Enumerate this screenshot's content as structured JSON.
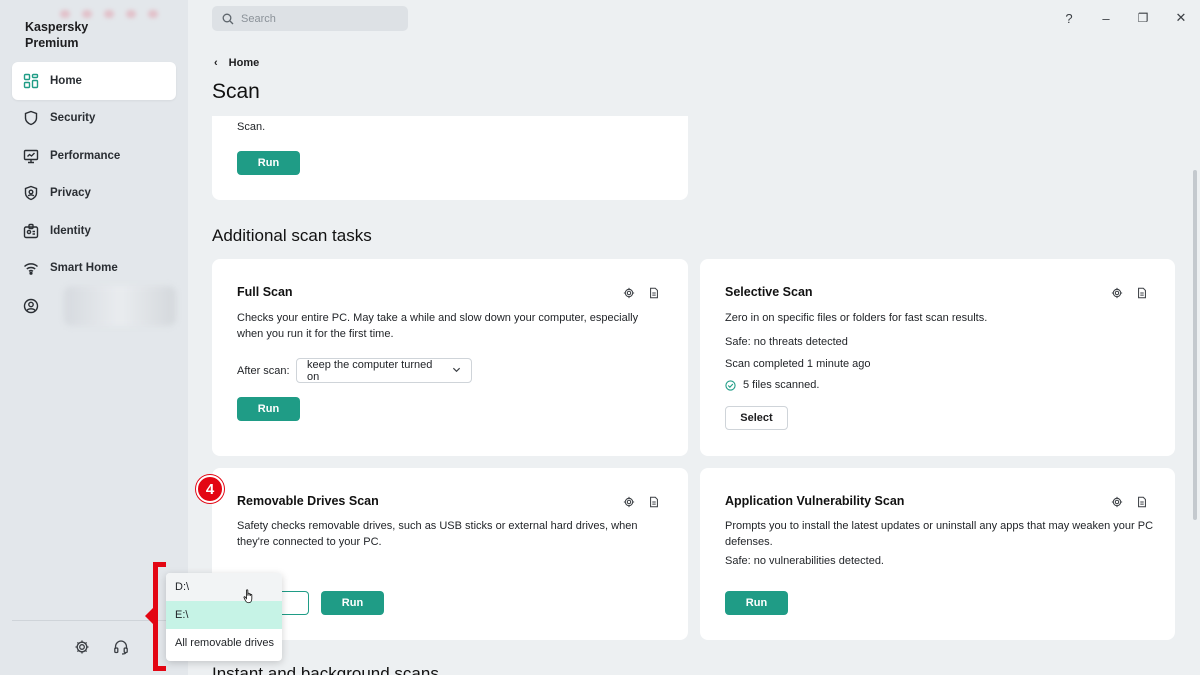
{
  "app": {
    "title_line1": "Kaspersky",
    "title_line2": "Premium"
  },
  "sidebar": {
    "items": [
      {
        "label": "Home",
        "icon": "home-icon",
        "active": true
      },
      {
        "label": "Security",
        "icon": "shield-icon"
      },
      {
        "label": "Performance",
        "icon": "performance-icon"
      },
      {
        "label": "Privacy",
        "icon": "privacy-icon"
      },
      {
        "label": "Identity",
        "icon": "identity-icon"
      },
      {
        "label": "Smart Home",
        "icon": "wifi-icon"
      }
    ],
    "bottom_icons": [
      "gear-icon",
      "headset-icon"
    ]
  },
  "search": {
    "placeholder": "Search"
  },
  "window_controls": {
    "help": "?",
    "minimize": "–",
    "restore": "❐",
    "close": "✕"
  },
  "breadcrumb": {
    "label": "Home"
  },
  "page": {
    "title": "Scan"
  },
  "quick_scan": {
    "desc_tail": "Scan.",
    "run_label": "Run"
  },
  "additional": {
    "section_title": "Additional scan tasks",
    "full_scan": {
      "title": "Full Scan",
      "desc": "Checks your entire PC. May take a while and slow down your computer, especially when you run it for the first time.",
      "after_scan_label": "After scan:",
      "after_scan_value": "keep the computer turned on",
      "run_label": "Run"
    },
    "selective_scan": {
      "title": "Selective Scan",
      "desc": "Zero in on specific files or folders for fast scan results.",
      "status": "Safe: no threats detected",
      "completed": "Scan completed 1 minute ago",
      "files_scanned": "5 files scanned.",
      "select_label": "Select"
    },
    "removable_scan": {
      "title": "Removable Drives Scan",
      "desc": "Safety checks removable drives, such as USB sticks or external hard drives, when they're connected to your PC.",
      "run_label": "Run"
    },
    "app_vuln_scan": {
      "title": "Application Vulnerability Scan",
      "desc": "Prompts you to install the latest updates or uninstall any apps that may weaken your PC defenses.",
      "status": "Safe: no vulnerabilities detected.",
      "run_label": "Run"
    }
  },
  "next_section_title": "Instant and background scans",
  "drive_menu": {
    "options": [
      "D:\\",
      "E:\\",
      "All removable drives"
    ],
    "hovered": "D:\\",
    "selected": "E:\\"
  },
  "annotation": {
    "step": "4"
  },
  "colors": {
    "accent": "#1f9c86",
    "annotation": "#e30613",
    "selected_row": "#c6f3e6"
  }
}
